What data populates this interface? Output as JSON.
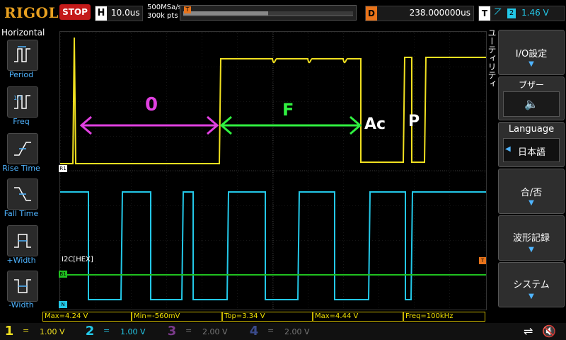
{
  "brand": "RIGOL",
  "run_state": "STOP",
  "horizontal": {
    "letter": "H",
    "timebase": "10.0us"
  },
  "sample": {
    "rate": "500MSa/s",
    "points": "300k pts"
  },
  "delay": {
    "letter": "D",
    "value": "238.000000us"
  },
  "trigger": {
    "letter": "T",
    "edge_icon": "rising-edge-icon",
    "channel": "2",
    "level": "1.46 V"
  },
  "left_menu": {
    "title": "Horizontal",
    "items": [
      {
        "label": "Period",
        "icon": "period-icon"
      },
      {
        "label": "Freq",
        "icon": "freq-icon"
      },
      {
        "label": "Rise Time",
        "icon": "rise-time-icon"
      },
      {
        "label": "Fall Time",
        "icon": "fall-time-icon"
      },
      {
        "label": "+Width",
        "icon": "pos-width-icon"
      },
      {
        "label": "-Width",
        "icon": "neg-width-icon"
      }
    ]
  },
  "right_menu": {
    "title": "ユーティリティ",
    "items": [
      {
        "label": "I/O設定",
        "arrow": "▼"
      },
      {
        "label": "ブザー",
        "value_icon": "speaker-icon"
      },
      {
        "label": "Language",
        "value": "日本語"
      },
      {
        "label": "合/否",
        "arrow": "▼"
      },
      {
        "label": "波形記録",
        "arrow": "▼"
      },
      {
        "label": "システム",
        "arrow": "▼"
      }
    ]
  },
  "screen": {
    "decode_label": "I2C[HEX]",
    "markers": {
      "ch1": "R1",
      "bus": "B1",
      "ch2": "N",
      "trig_right": "T"
    },
    "annotations": [
      {
        "text": "0",
        "color": "#e040e0"
      },
      {
        "text": "F",
        "color": "#30f040"
      },
      {
        "text": "Ac",
        "color": "#ffffff"
      },
      {
        "text": "P",
        "color": "#ffffff"
      }
    ]
  },
  "measurements": [
    {
      "label": "Max=4.24 V"
    },
    {
      "label": "Min=-560mV"
    },
    {
      "label": "Top=3.34 V"
    },
    {
      "label": "Max=4.44 V"
    },
    {
      "label": "Freq=100kHz"
    }
  ],
  "channels": [
    {
      "num": "1",
      "coupling": "=",
      "scale": "1.00 V",
      "color": "#f0e020",
      "active": true
    },
    {
      "num": "2",
      "coupling": "=",
      "scale": "1.00 V",
      "color": "#23c8e8",
      "active": true
    },
    {
      "num": "3",
      "coupling": "=",
      "scale": "2.00 V",
      "color": "#a040c0",
      "active": false
    },
    {
      "num": "4",
      "coupling": "=",
      "scale": "2.00 V",
      "color": "#3060d0",
      "active": false
    }
  ],
  "status_icons": [
    "usb-icon",
    "speaker-muted-icon"
  ],
  "colors": {
    "ch1": "#f0e020",
    "ch2": "#23c8e8",
    "bus": "#20c020",
    "accent": "#e8731a"
  }
}
